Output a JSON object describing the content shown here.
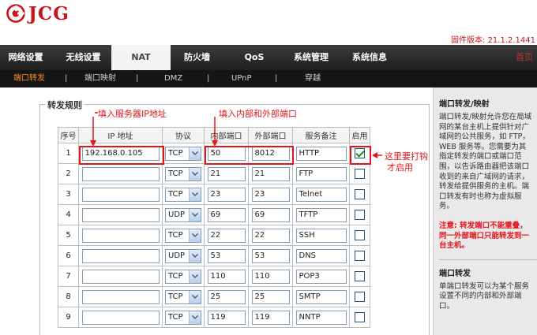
{
  "brand": {
    "logo_text": "JCG",
    "firmware_version": "固件版本: 21.1.2.1441"
  },
  "main_nav": {
    "items": [
      "网络设置",
      "无线设置",
      "NAT",
      "防火墙",
      "QoS",
      "系统管理",
      "系统信息",
      "首页"
    ],
    "active": "NAT"
  },
  "sub_nav": {
    "items": [
      "端口转发",
      "端口映射",
      "DMZ",
      "UPnP",
      "穿越"
    ],
    "active": "端口转发",
    "separator": "|"
  },
  "form": {
    "legend": "转发规则",
    "headers": [
      "序号",
      "IP 地址",
      "协议",
      "内部端口",
      "外部端口",
      "服务备注",
      "启用"
    ],
    "rows": [
      {
        "no": "1",
        "ip": "192.168.0.105",
        "protocol": "TCP",
        "internal": "50",
        "external": "8012",
        "note": "HTTP",
        "enabled": true
      },
      {
        "no": "2",
        "ip": "",
        "protocol": "TCP",
        "internal": "21",
        "external": "21",
        "note": "FTP",
        "enabled": false
      },
      {
        "no": "3",
        "ip": "",
        "protocol": "TCP",
        "internal": "23",
        "external": "23",
        "note": "Telnet",
        "enabled": false
      },
      {
        "no": "4",
        "ip": "",
        "protocol": "UDP",
        "internal": "69",
        "external": "69",
        "note": "TFTP",
        "enabled": false
      },
      {
        "no": "5",
        "ip": "",
        "protocol": "TCP",
        "internal": "22",
        "external": "22",
        "note": "SSH",
        "enabled": false
      },
      {
        "no": "6",
        "ip": "",
        "protocol": "UDP",
        "internal": "53",
        "external": "53",
        "note": "DNS",
        "enabled": false
      },
      {
        "no": "7",
        "ip": "",
        "protocol": "TCP",
        "internal": "110",
        "external": "110",
        "note": "POP3",
        "enabled": false
      },
      {
        "no": "8",
        "ip": "",
        "protocol": "TCP",
        "internal": "25",
        "external": "25",
        "note": "SMTP",
        "enabled": false
      },
      {
        "no": "9",
        "ip": "",
        "protocol": "TCP",
        "internal": "119",
        "external": "119",
        "note": "NNTP",
        "enabled": false
      }
    ]
  },
  "annotations": {
    "ip_hint": "填入服务器IP地址",
    "port_hint": "填入内部和外部端口",
    "enable_hint_line1": "这里要打钩",
    "enable_hint_line2": "才启用"
  },
  "help": {
    "title1": "端口转发/映射",
    "body1": "端口转发/映射允许您在局域\n网的某台主机上提供针对广\n域网的公共服务，如 FTP，\nWEB 服务等。您需要为其\n指定转发的端口或端口范\n围，以告诉路由器把该端口\n收到的来自广域网的请求，\n转发给提供服务的主机。端\n口转发有时也称为虚拟服\n务。",
    "warning": "注意: 转发端口不能重叠，\n同一外部端口只能转发到一\n台主机。",
    "title2": "端口转发",
    "body2": "单端口转发可以为某个服务\n设置不同的内部和外部端\n口。"
  },
  "colors": {
    "accent_red": "#e4141b",
    "brand_red": "#c8141b",
    "subnav_active": "#ff8a1e"
  }
}
